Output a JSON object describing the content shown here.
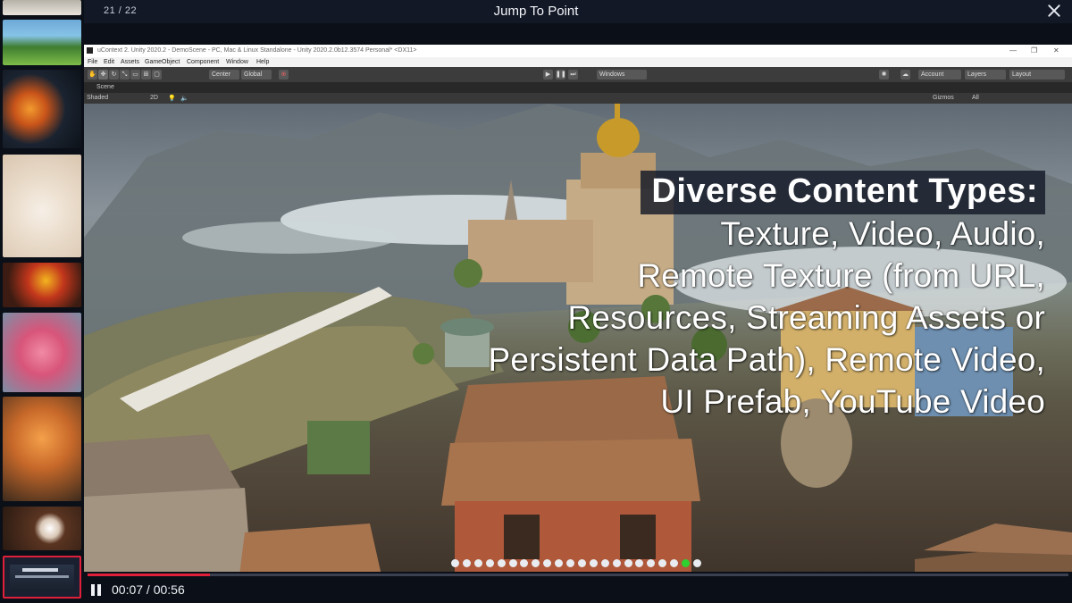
{
  "header": {
    "counter": "21 / 22",
    "title": "Jump To Point"
  },
  "unity": {
    "window_title": "uContext 2. Unity 2020.2 - DemoScene - PC, Mac & Linux Standalone - Unity 2020.2.0b12.3574 Personal* <DX11>",
    "menu": [
      "File",
      "Edit",
      "Assets",
      "GameObject",
      "Component",
      "Window",
      "Help"
    ],
    "toolbar": {
      "center": "Center",
      "global": "Global",
      "platform": "Windows",
      "account": "Account",
      "layers": "Layers",
      "layout": "Layout"
    },
    "scene_tab": "Scene",
    "shading": "Shaded",
    "mode_2d": "2D",
    "gizmos": "Gizmos",
    "search_placeholder": "All"
  },
  "caption": {
    "heading": "Diverse Content Types:",
    "lines": [
      "Texture, Video, Audio,",
      "Remote Texture (from URL,",
      "Resources, Streaming Assets or",
      "Persistent Data Path), Remote Video,",
      "UI Prefab, YouTube Video"
    ]
  },
  "pagination": {
    "total": 22,
    "active_index": 20
  },
  "player": {
    "time": "00:07 / 00:56",
    "progress": 0.125
  },
  "colors": {
    "accent": "#e0203a",
    "active_dot": "#2fd12f"
  }
}
